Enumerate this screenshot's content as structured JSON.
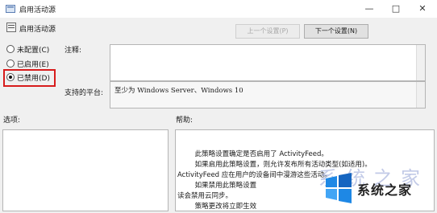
{
  "window": {
    "title": "启用活动源",
    "controls": {
      "minimize": "—",
      "maximize": "□",
      "close": "✕"
    }
  },
  "policy": {
    "name": "启用活动源"
  },
  "nav": {
    "prev_label": "上一个设置(P)",
    "next_label": "下一个设置(N)"
  },
  "state_options": [
    {
      "label": "未配置(C)",
      "selected": false
    },
    {
      "label": "已启用(E)",
      "selected": false
    },
    {
      "label": "已禁用(D)",
      "selected": true
    }
  ],
  "labels": {
    "comment": "注释:",
    "platform": "支持的平台:",
    "options": "选项:",
    "help": "帮助:"
  },
  "platform_value": "至少为 Windows Server、Windows 10",
  "help_lines": [
    "        此策略设置确定是否启用了 ActivityFeed。",
    "        如果启用此策略设置，则允许发布所有活动类型(如适用)。",
    "ActivityFeed 应在用户的设备间中漫游这些活动。",
    "        如果禁用此策略设置",
    "读会禁用云同步。",
    "        策略更改将立即生效"
  ],
  "watermark": {
    "text": "系统之家",
    "faint_text": "系统之家"
  },
  "colors": {
    "highlight": "#d71c1c",
    "background": "#f0f0f0"
  }
}
